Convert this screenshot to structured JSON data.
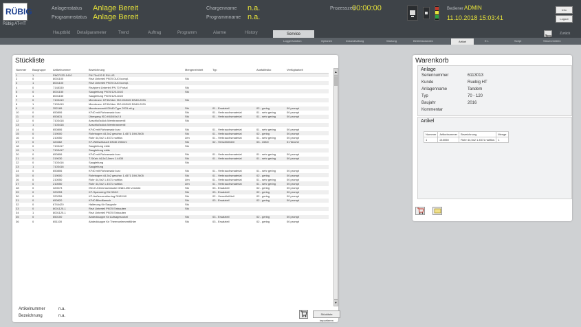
{
  "header": {
    "logo_text": "RÜBIG",
    "plant_name": "Rübig AT-HT",
    "anlagenstatus_label": "Anlagenstatus",
    "anlagenstatus_value": "Anlage Bereit",
    "programmstatus_label": "Programmstatus",
    "programmstatus_value": "Anlage Bereit",
    "chargenname_label": "Chargenname",
    "chargenname_value": "n.a.",
    "programmname_label": "Programmname",
    "programmname_value": "n.a.",
    "prozesszeit_label": "Prozesszeit",
    "prozesszeit_value": "00:00:00",
    "user_label": "Bediener",
    "user_value": "ADMIN",
    "datetime": "11.10.2018 15:03:41",
    "btn_info": "Info",
    "btn_logout": "Logout"
  },
  "nav": {
    "items": [
      "Hauptbild",
      "Detailparameter",
      "Trend",
      "Auftrag",
      "Programm",
      "Alarme",
      "History"
    ],
    "active": "Service",
    "back": "Zurück"
  },
  "subnav": {
    "items": [
      "Loggerfunktion",
      "Optionen",
      "Instandhaltung",
      "Wartung",
      "Betriebsstunden"
    ],
    "active": "Artikel",
    "right_items": [
      "E.I.",
      "Script",
      "Steuerventilen"
    ]
  },
  "stueckliste": {
    "title": "Stückliste",
    "columns": [
      "Nummer",
      "Baugruppe",
      "Artikelnummer",
      "Bezeichnung",
      "Mengeneinheit",
      "Typ",
      "Ausfallrisiko",
      "Verfügbarkeit"
    ],
    "rows": [
      [
        "1",
        "1",
        "PN0712D-1410",
        "PN 70x120 D RU-US",
        "",
        "",
        "",
        ""
      ],
      [
        "2",
        "0",
        "8001100",
        "Rezi Unterteil PN70 DUO kompl.",
        "Stk",
        "",
        "",
        ""
      ],
      [
        "3",
        "1",
        "8001100",
        "Rezi Unterteil PN70 DUO kompl.",
        "",
        "",
        "",
        ""
      ],
      [
        "4",
        "0",
        "7148150",
        "Rezipient Unterteil PN 70 Portal",
        "Stk",
        "",
        "",
        ""
      ],
      [
        "5",
        "0",
        "8001150",
        "Saugleitung PN70/120-DUO",
        "Stk",
        "",
        "",
        ""
      ],
      [
        "6",
        "1",
        "8001150",
        "Saugleitung PN70/120-DUO",
        "",
        "",
        "",
        ""
      ],
      [
        "7",
        "0",
        "7103419",
        "Membranv. KF40/über ISO-K63/45 DN40-2031",
        "Stk",
        "",
        "",
        ""
      ],
      [
        "8",
        "1",
        "7103419",
        "Membranv. KF40/über ISO-K63/45 DN40-2031",
        "",
        "",
        "",
        ""
      ],
      [
        "9",
        "0",
        "352189",
        "Membranventil DN40 Type 2031 alt.g.",
        "Stk",
        "01 - Ersatzteil",
        "02 - gering",
        "00 prompt"
      ],
      [
        "10",
        "0",
        "650806",
        "KF40 mit Rohransatz kurz",
        "Stk",
        "01 - Verbrauchsmaterial",
        "01 - sehr gering",
        "00 prompt"
      ],
      [
        "11",
        "0",
        "650831",
        "Übergang ISO-K63/45x2.5",
        "Stk",
        "01 - Verbrauchsmaterial",
        "01 - sehr gering",
        "00 prompt"
      ],
      [
        "12",
        "0",
        "7103418",
        "Anschlußstück Membranventil",
        "Stk",
        "",
        "",
        ""
      ],
      [
        "13",
        "1",
        "7103418",
        "Anschlußstück Membranventil",
        "",
        "",
        "",
        ""
      ],
      [
        "14",
        "0",
        "650806",
        "KF40 mit Rohransatz kurz",
        "Stk",
        "01 - Verbrauchsmaterial",
        "01 - sehr gering",
        "00 prompt"
      ],
      [
        "15",
        "0",
        "319000",
        "Rohrbogen 44,5x2 geschw. 1.4571 DIN 2605",
        "Stk",
        "01 - Verbrauchsmaterial",
        "02 - gering",
        "00 prompt"
      ],
      [
        "16",
        "0",
        "210050",
        "Rohr 44,5x2 1.4571 nahtlos",
        "Lfm",
        "01 - Verbrauchsmaterial",
        "01 - sehr gering",
        "00 prompt"
      ],
      [
        "17",
        "0",
        "320462",
        "KF-Wellschlauch DN40 250mm",
        "Stk",
        "02 - Verschleißteil",
        "03 - mittel",
        "01 Woche"
      ],
      [
        "18",
        "0",
        "7103417",
        "Saugleitung mitte",
        "Stk",
        "",
        "",
        ""
      ],
      [
        "19",
        "1",
        "7103417",
        "Saugleitung mitte",
        "",
        "",
        "",
        ""
      ],
      [
        "20",
        "0",
        "650806",
        "KF40 mit Rohransatz kurz",
        "Stk",
        "01 - Verbrauchsmaterial",
        "01 - sehr gering",
        "00 prompt"
      ],
      [
        "21",
        "0",
        "319030",
        "T-Stück 44,5x2,0mm 1.4435",
        "Stk",
        "01 - Verbrauchsmaterial",
        "01 - sehr gering",
        "00 prompt"
      ],
      [
        "22",
        "0",
        "7103416",
        "Saugleitung",
        "Stk",
        "",
        "",
        ""
      ],
      [
        "23",
        "1",
        "7103416",
        "Saugleitung",
        "",
        "",
        "",
        ""
      ],
      [
        "24",
        "0",
        "650806",
        "KF40 mit Rohransatz kurz",
        "Stk",
        "01 - Verbrauchsmaterial",
        "01 - sehr gering",
        "00 prompt"
      ],
      [
        "25",
        "0",
        "319000",
        "Rohrbogen 44,5x2 geschw. 1.4571 DIN 2605",
        "Stk",
        "01 - Verbrauchsmaterial",
        "02 - gering",
        "00 prompt"
      ],
      [
        "26",
        "0",
        "210050",
        "Rohr 44,5x2 1.4571 nahtlos",
        "Lfm",
        "01 - Verbrauchsmaterial",
        "01 - sehr gering",
        "00 prompt"
      ],
      [
        "27",
        "0",
        "210050",
        "Rohr 44,5x2 1.4571 nahtlos",
        "Lfm",
        "01 - Verbrauchsmaterial",
        "01 - sehr gering",
        "00 prompt"
      ],
      [
        "28",
        "0",
        "320073",
        "ISO-K-Klemmschraube DN63-250 verzinkt",
        "Stk",
        "03 - Ersatzteil",
        "02 - gering",
        "00 prompt"
      ],
      [
        "29",
        "0",
        "320253",
        "KF-Spannring DN 32/40",
        "Stk",
        "03 - Ersatzteil",
        "02 - gering",
        "00 prompt"
      ],
      [
        "30",
        "0",
        "320259",
        "KF-Außenzentrierring DN32/40",
        "Stk",
        "02 - Verschleißteil",
        "02 - gering",
        "00 prompt"
      ],
      [
        "31",
        "0",
        "650820",
        "KF40 Blindflansch",
        "Stk",
        "03 - Ersatzteil",
        "02 - gering",
        "00 prompt"
      ],
      [
        "32",
        "0",
        "6744420",
        "Halterung für Saugrohr",
        "Stk",
        "",
        "",
        ""
      ],
      [
        "33",
        "0",
        "8001120-1",
        "Rezi Unterteil PN70 Einbauten",
        "Stk",
        "",
        "",
        ""
      ],
      [
        "34",
        "1",
        "8001120-1",
        "Rezi Unterteil PN70 Einbauten",
        "",
        "",
        "",
        ""
      ],
      [
        "35",
        "0",
        "650100",
        "Abdeckkappe für Aufsagesockel",
        "Stk",
        "03 - Ersatzteil",
        "02 - gering",
        "00 prompt"
      ],
      [
        "36",
        "0",
        "651100",
        "Abdeckkappe für Thermoelementfühler",
        "Stk",
        "03 - Ersatzteil",
        "02 - gering",
        "00 prompt"
      ]
    ],
    "footer_artikelnummer_label": "Artikelnummer",
    "footer_artikelnummer_value": "n.a.",
    "footer_bezeichnung_label": "Bezeichnung",
    "footer_bezeichnung_value": "n.a.",
    "import_button": "Stückliste importieren"
  },
  "warenkorb": {
    "title": "Warenkorb",
    "anlage_title": "Anlage",
    "fields": [
      {
        "label": "Seriennummer",
        "value": "6113013"
      },
      {
        "label": "Kunde",
        "value": "Ruebig HT"
      },
      {
        "label": "Anlagenname",
        "value": "Tandem"
      },
      {
        "label": "Typ",
        "value": "70 - 120"
      },
      {
        "label": "Baujahr",
        "value": "2016"
      },
      {
        "label": "Kommentar",
        "value": ""
      }
    ],
    "artikel_title": "Artikel",
    "artikel_columns": [
      "Nummer",
      "Artikelnummer",
      "Bezeichnung",
      "Menge"
    ],
    "artikel_rows": [
      [
        "1",
        "210050",
        "Rohr 44,5x2 1.4571 nahtlos",
        "1"
      ]
    ]
  },
  "colors": {
    "accent": "#e6e23a",
    "header_bg": "#3e4348",
    "page_bg": "#cfd1d3"
  }
}
